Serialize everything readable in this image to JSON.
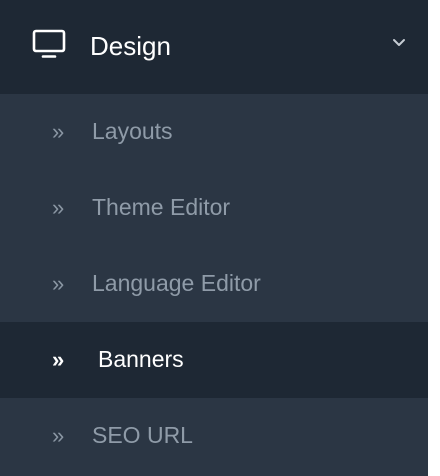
{
  "menu": {
    "parent": {
      "label": "Design",
      "icon": "monitor-icon",
      "chevron_icon": "chevron-down-icon"
    },
    "items": [
      {
        "label": "Layouts",
        "bullet": "»",
        "active": false
      },
      {
        "label": "Theme Editor",
        "bullet": "»",
        "active": false
      },
      {
        "label": "Language Editor",
        "bullet": "»",
        "active": false
      },
      {
        "label": "Banners",
        "bullet": "»",
        "active": true
      },
      {
        "label": "SEO URL",
        "bullet": "»",
        "active": false
      }
    ]
  },
  "colors": {
    "background": "#2b3644",
    "active_background": "#1e2834",
    "text": "#8f9ba8",
    "active_text": "#ffffff"
  }
}
